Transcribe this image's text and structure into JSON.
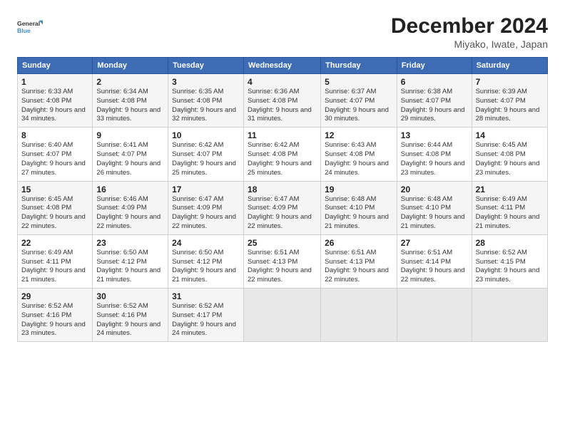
{
  "logo": {
    "line1": "General",
    "line2": "Blue"
  },
  "header": {
    "title": "December 2024",
    "subtitle": "Miyako, Iwate, Japan"
  },
  "columns": [
    "Sunday",
    "Monday",
    "Tuesday",
    "Wednesday",
    "Thursday",
    "Friday",
    "Saturday"
  ],
  "weeks": [
    [
      {
        "day": "1",
        "sunrise": "6:33 AM",
        "sunset": "4:08 PM",
        "daylight": "9 hours and 34 minutes."
      },
      {
        "day": "2",
        "sunrise": "6:34 AM",
        "sunset": "4:08 PM",
        "daylight": "9 hours and 33 minutes."
      },
      {
        "day": "3",
        "sunrise": "6:35 AM",
        "sunset": "4:08 PM",
        "daylight": "9 hours and 32 minutes."
      },
      {
        "day": "4",
        "sunrise": "6:36 AM",
        "sunset": "4:08 PM",
        "daylight": "9 hours and 31 minutes."
      },
      {
        "day": "5",
        "sunrise": "6:37 AM",
        "sunset": "4:07 PM",
        "daylight": "9 hours and 30 minutes."
      },
      {
        "day": "6",
        "sunrise": "6:38 AM",
        "sunset": "4:07 PM",
        "daylight": "9 hours and 29 minutes."
      },
      {
        "day": "7",
        "sunrise": "6:39 AM",
        "sunset": "4:07 PM",
        "daylight": "9 hours and 28 minutes."
      }
    ],
    [
      {
        "day": "8",
        "sunrise": "6:40 AM",
        "sunset": "4:07 PM",
        "daylight": "9 hours and 27 minutes."
      },
      {
        "day": "9",
        "sunrise": "6:41 AM",
        "sunset": "4:07 PM",
        "daylight": "9 hours and 26 minutes."
      },
      {
        "day": "10",
        "sunrise": "6:42 AM",
        "sunset": "4:07 PM",
        "daylight": "9 hours and 25 minutes."
      },
      {
        "day": "11",
        "sunrise": "6:42 AM",
        "sunset": "4:08 PM",
        "daylight": "9 hours and 25 minutes."
      },
      {
        "day": "12",
        "sunrise": "6:43 AM",
        "sunset": "4:08 PM",
        "daylight": "9 hours and 24 minutes."
      },
      {
        "day": "13",
        "sunrise": "6:44 AM",
        "sunset": "4:08 PM",
        "daylight": "9 hours and 23 minutes."
      },
      {
        "day": "14",
        "sunrise": "6:45 AM",
        "sunset": "4:08 PM",
        "daylight": "9 hours and 23 minutes."
      }
    ],
    [
      {
        "day": "15",
        "sunrise": "6:45 AM",
        "sunset": "4:08 PM",
        "daylight": "9 hours and 22 minutes."
      },
      {
        "day": "16",
        "sunrise": "6:46 AM",
        "sunset": "4:09 PM",
        "daylight": "9 hours and 22 minutes."
      },
      {
        "day": "17",
        "sunrise": "6:47 AM",
        "sunset": "4:09 PM",
        "daylight": "9 hours and 22 minutes."
      },
      {
        "day": "18",
        "sunrise": "6:47 AM",
        "sunset": "4:09 PM",
        "daylight": "9 hours and 22 minutes."
      },
      {
        "day": "19",
        "sunrise": "6:48 AM",
        "sunset": "4:10 PM",
        "daylight": "9 hours and 21 minutes."
      },
      {
        "day": "20",
        "sunrise": "6:48 AM",
        "sunset": "4:10 PM",
        "daylight": "9 hours and 21 minutes."
      },
      {
        "day": "21",
        "sunrise": "6:49 AM",
        "sunset": "4:11 PM",
        "daylight": "9 hours and 21 minutes."
      }
    ],
    [
      {
        "day": "22",
        "sunrise": "6:49 AM",
        "sunset": "4:11 PM",
        "daylight": "9 hours and 21 minutes."
      },
      {
        "day": "23",
        "sunrise": "6:50 AM",
        "sunset": "4:12 PM",
        "daylight": "9 hours and 21 minutes."
      },
      {
        "day": "24",
        "sunrise": "6:50 AM",
        "sunset": "4:12 PM",
        "daylight": "9 hours and 21 minutes."
      },
      {
        "day": "25",
        "sunrise": "6:51 AM",
        "sunset": "4:13 PM",
        "daylight": "9 hours and 22 minutes."
      },
      {
        "day": "26",
        "sunrise": "6:51 AM",
        "sunset": "4:13 PM",
        "daylight": "9 hours and 22 minutes."
      },
      {
        "day": "27",
        "sunrise": "6:51 AM",
        "sunset": "4:14 PM",
        "daylight": "9 hours and 22 minutes."
      },
      {
        "day": "28",
        "sunrise": "6:52 AM",
        "sunset": "4:15 PM",
        "daylight": "9 hours and 23 minutes."
      }
    ],
    [
      {
        "day": "29",
        "sunrise": "6:52 AM",
        "sunset": "4:16 PM",
        "daylight": "9 hours and 23 minutes."
      },
      {
        "day": "30",
        "sunrise": "6:52 AM",
        "sunset": "4:16 PM",
        "daylight": "9 hours and 24 minutes."
      },
      {
        "day": "31",
        "sunrise": "6:52 AM",
        "sunset": "4:17 PM",
        "daylight": "9 hours and 24 minutes."
      },
      null,
      null,
      null,
      null
    ]
  ]
}
